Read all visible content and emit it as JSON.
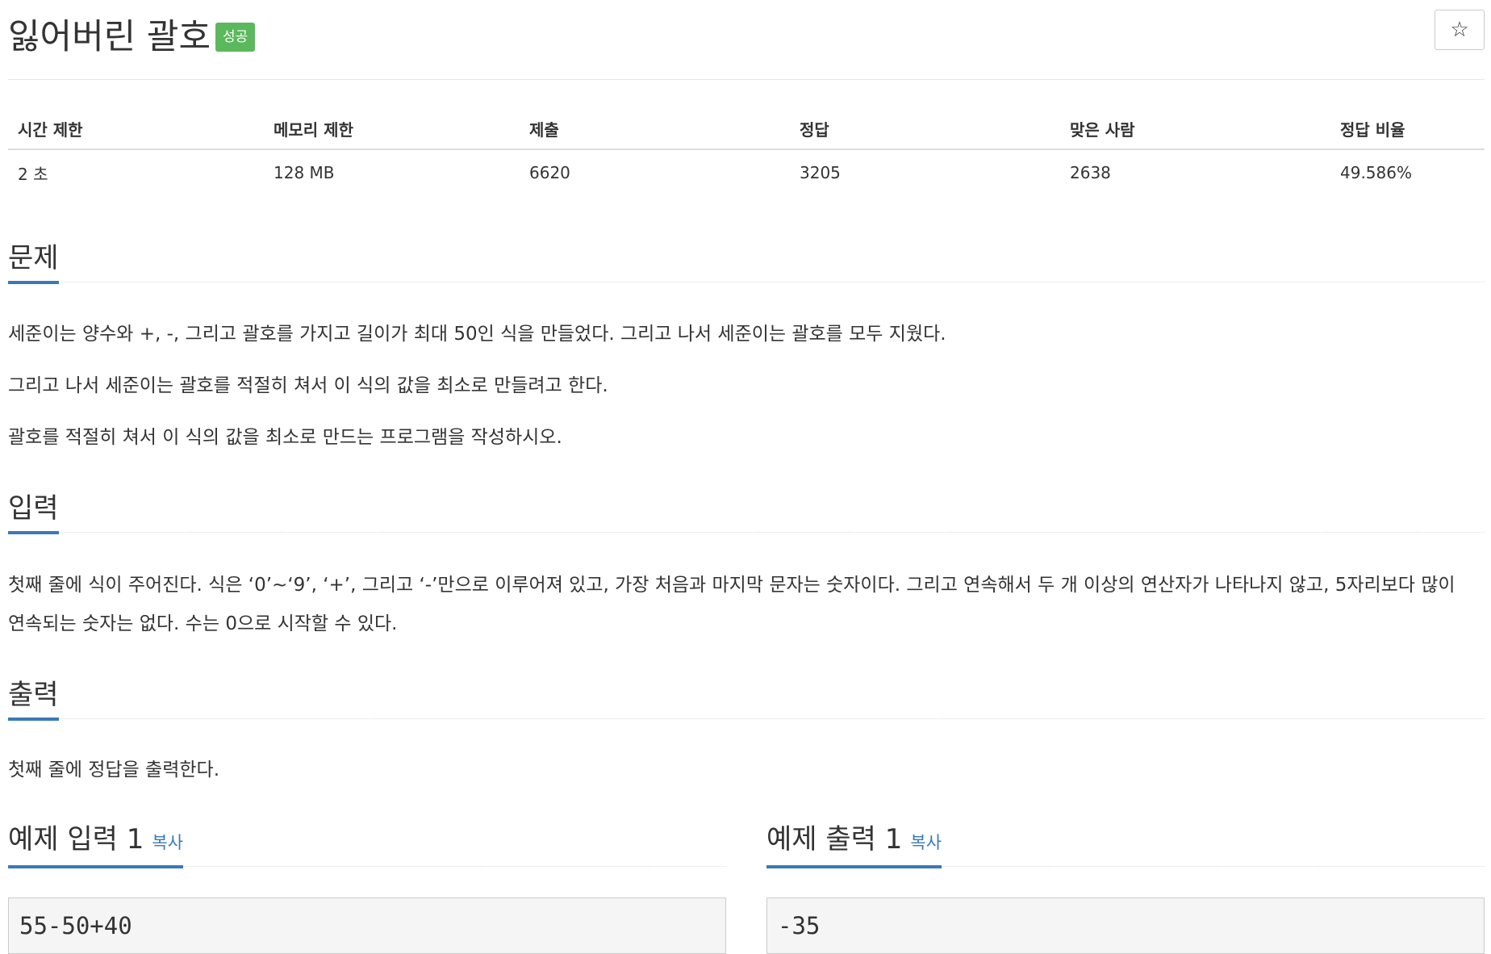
{
  "problem": {
    "title": "잃어버린 괄호",
    "badge": "성공",
    "star_icon": "☆"
  },
  "info": {
    "headers": [
      "시간 제한",
      "메모리 제한",
      "제출",
      "정답",
      "맞은 사람",
      "정답 비율"
    ],
    "values": [
      "2 초",
      "128 MB",
      "6620",
      "3205",
      "2638",
      "49.586%"
    ]
  },
  "sections": {
    "problem": {
      "heading": "문제",
      "paragraphs": [
        "세준이는 양수와 +, -, 그리고 괄호를 가지고 길이가 최대 50인 식을 만들었다. 그리고 나서 세준이는 괄호를 모두 지웠다.",
        "그리고 나서 세준이는 괄호를 적절히 쳐서 이 식의 값을 최소로 만들려고 한다.",
        "괄호를 적절히 쳐서 이 식의 값을 최소로 만드는 프로그램을 작성하시오."
      ]
    },
    "input": {
      "heading": "입력",
      "paragraph": "첫째 줄에 식이 주어진다. 식은 ‘0’~‘9’, ‘+’, 그리고 ‘-’만으로 이루어져 있고, 가장 처음과 마지막 문자는 숫자이다. 그리고 연속해서 두 개 이상의 연산자가 나타나지 않고, 5자리보다 많이 연속되는 숫자는 없다. 수는 0으로 시작할 수 있다."
    },
    "output": {
      "heading": "출력",
      "paragraph": "첫째 줄에 정답을 출력한다."
    }
  },
  "samples": {
    "input": {
      "heading": "예제 입력 1",
      "copy": "복사",
      "content": "55-50+40"
    },
    "output": {
      "heading": "예제 출력 1",
      "copy": "복사",
      "content": "-35"
    }
  }
}
